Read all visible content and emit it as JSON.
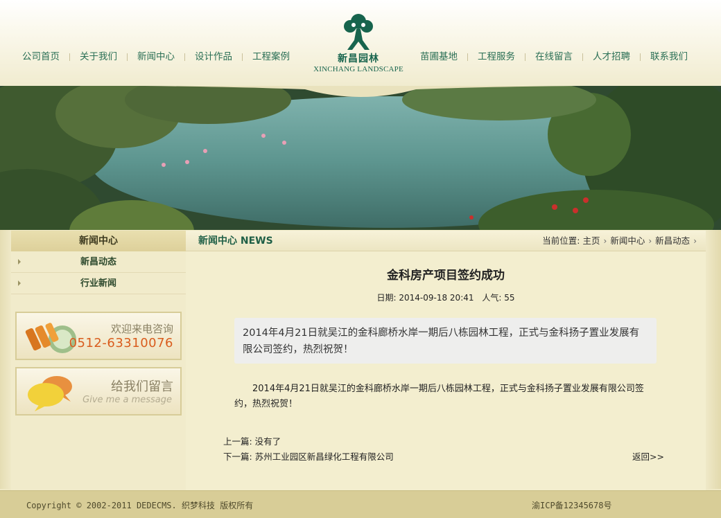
{
  "nav": {
    "left": [
      "公司首页",
      "关于我们",
      "新闻中心",
      "设计作品",
      "工程案例"
    ],
    "right": [
      "苗圃基地",
      "工程服务",
      "在线留言",
      "人才招聘",
      "联系我们"
    ]
  },
  "logo": {
    "cn": "新昌园林",
    "en": "XINCHANG LANDSCAPE",
    "icon": "tree-logo-icon",
    "color": "#17644d"
  },
  "sidebar": {
    "title": "新闻中心",
    "items": [
      {
        "label": "新昌动态"
      },
      {
        "label": "行业新闻"
      }
    ],
    "promo_call": {
      "title": "欢迎来电咨询",
      "phone": "0512-63310076",
      "icon": "phone-gift-icon"
    },
    "promo_msg": {
      "title": "给我们留言",
      "subtitle": "Give me a message",
      "icon": "chat-bubbles-icon"
    }
  },
  "content": {
    "header_title": "新闻中心 NEWS",
    "breadcrumb": {
      "prefix": "当前位置:",
      "items": [
        "主页",
        "新闻中心",
        "新昌动态"
      ]
    },
    "article": {
      "title": "金科房产项目签约成功",
      "date_label": "日期: 2014-09-18 20:41",
      "views_label": "人气: 55",
      "summary": "2014年4月21日就吴江的金科廊桥水岸一期后八栋园林工程，正式与金科扬子置业发展有限公司签约，热烈祝贺！",
      "body": "2014年4月21日就吴江的金科廊桥水岸一期后八栋园林工程，正式与金科扬子置业发展有限公司签约，热烈祝贺！"
    },
    "prev": "上一篇: 没有了",
    "next_prefix": "下一篇: ",
    "next_link": "苏州工业园区新昌绿化工程有限公司",
    "back": "返回>>"
  },
  "footer": {
    "copyright": "Copyright © 2002-2011 DEDECMS. 织梦科技 版权所有",
    "icp": "渝ICP备12345678号"
  },
  "colors": {
    "accent": "#1f5f46",
    "nav": "#2a6f55",
    "phone": "#d95c1d"
  }
}
